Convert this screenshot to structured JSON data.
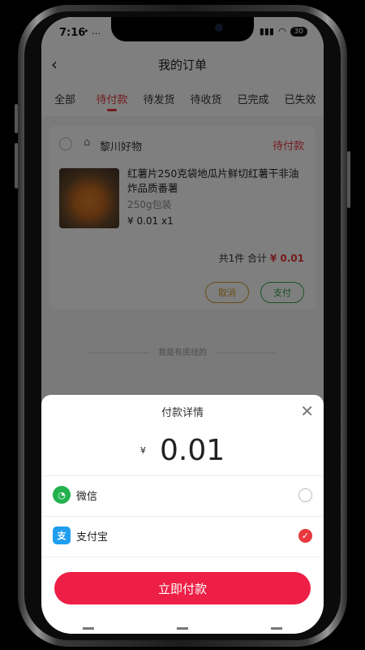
{
  "status_bar": {
    "time": "7:16",
    "left_icons": "• …",
    "battery": "30"
  },
  "nav": {
    "title": "我的订单"
  },
  "tabs": [
    {
      "label": "全部",
      "active": false
    },
    {
      "label": "待付款",
      "active": true
    },
    {
      "label": "待发货",
      "active": false
    },
    {
      "label": "待收货",
      "active": false
    },
    {
      "label": "已完成",
      "active": false
    },
    {
      "label": "已失效",
      "active": false
    }
  ],
  "order": {
    "store_name": "黎川好物",
    "status": "待付款",
    "product_title": "红薯片250克袋地瓜片鲜切红薯干非油炸品质番薯",
    "spec": "250g包装",
    "price_qty": "¥ 0.01 x1",
    "summary_prefix": "共1件 合计",
    "total": "¥ 0.01",
    "cancel_label": "取消",
    "pay_label": "支付"
  },
  "list_footer": "我是有底线的",
  "payment_sheet": {
    "title": "付款详情",
    "currency": "¥",
    "amount": "0.01",
    "methods": [
      {
        "label": "微信",
        "icon": "wechat-icon",
        "selected": false
      },
      {
        "label": "支付宝",
        "icon": "alipay-icon",
        "selected": true
      }
    ],
    "pay_now_label": "立即付款"
  },
  "colors": {
    "accent": "#e8383d",
    "pay_button": "#ee1f46",
    "wechat": "#23b14d",
    "alipay": "#1f9eef",
    "pay_green": "#35a34a",
    "cancel_gold": "#d59a2a"
  }
}
